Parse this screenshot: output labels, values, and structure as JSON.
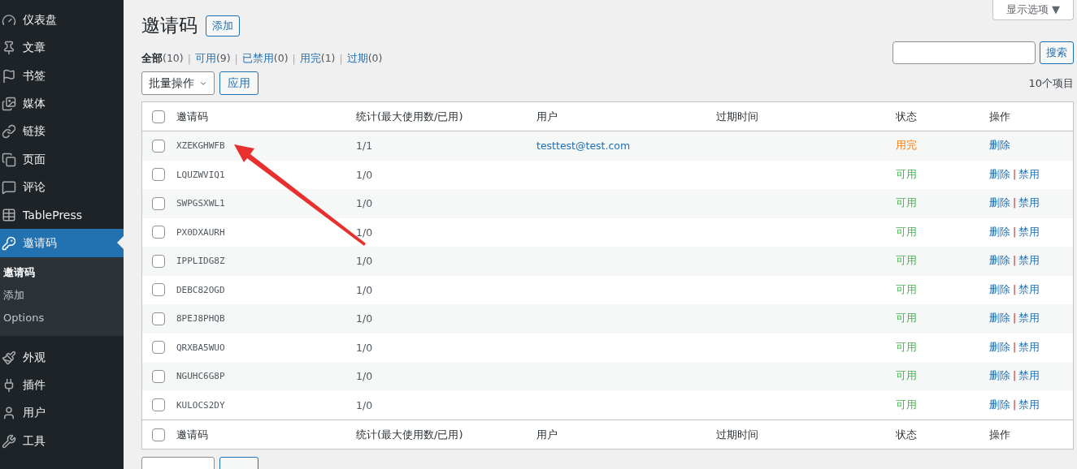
{
  "sidebar": {
    "items_top": [
      {
        "label": "仪表盘"
      },
      {
        "label": "文章"
      },
      {
        "label": "书签"
      },
      {
        "label": "媒体"
      },
      {
        "label": "链接"
      },
      {
        "label": "页面"
      },
      {
        "label": "评论"
      },
      {
        "label": "TablePress"
      },
      {
        "label": "邀请码",
        "selected": true
      }
    ],
    "submenu": [
      {
        "label": "邀请码",
        "selected": true
      },
      {
        "label": "添加",
        "selected": false
      },
      {
        "label": "Options",
        "selected": false
      }
    ],
    "items_bottom": [
      {
        "label": "外观"
      },
      {
        "label": "插件"
      },
      {
        "label": "用户"
      },
      {
        "label": "工具"
      }
    ]
  },
  "screen_options": "显示选项 ▼",
  "page_title": "邀请码",
  "add_button": "添加",
  "filters": {
    "separator": "|",
    "items": [
      {
        "label": "全部",
        "count": "(10)",
        "selected": true
      },
      {
        "label": "可用",
        "count": "(9)",
        "selected": false
      },
      {
        "label": "已禁用",
        "count": "(0)",
        "selected": false
      },
      {
        "label": "用完",
        "count": "(1)",
        "selected": false
      },
      {
        "label": "过期",
        "count": "(0)",
        "selected": false
      }
    ]
  },
  "search": {
    "button": "搜索"
  },
  "bulk": {
    "select": "批量操作",
    "apply": "应用",
    "count": "10个项目"
  },
  "table": {
    "header_checked": false,
    "footer_checked": false,
    "footer_columns": [
      "邀请码",
      "统计(最大使用数/已用)",
      "用户",
      "过期时间",
      "状态",
      "操作"
    ],
    "columns": [
      "邀请码",
      "统计(最大使用数/已用)",
      "用户",
      "过期时间",
      "状态",
      "操作"
    ],
    "action_separator": "|",
    "rows": [
      {
        "code": "XZEKGHWFB",
        "stats": "1/1",
        "user": "testtest@test.com",
        "status": {
          "label": "用完",
          "kind": "used"
        },
        "actions": [
          "删除"
        ],
        "checked": false
      },
      {
        "code": "LQUZWVIQ1",
        "stats": "1/0",
        "status": {
          "label": "可用",
          "kind": "available"
        },
        "actions": [
          "删除",
          "禁用"
        ],
        "checked": false
      },
      {
        "code": "SWPGSXWL1",
        "stats": "1/0",
        "status": {
          "label": "可用",
          "kind": "available"
        },
        "actions": [
          "删除",
          "禁用"
        ],
        "checked": false
      },
      {
        "code": "PX0DXAURH",
        "stats": "1/0",
        "status": {
          "label": "可用",
          "kind": "available"
        },
        "actions": [
          "删除",
          "禁用"
        ],
        "checked": false
      },
      {
        "code": "IPPLIDG8Z",
        "stats": "1/0",
        "status": {
          "label": "可用",
          "kind": "available"
        },
        "actions": [
          "删除",
          "禁用"
        ],
        "checked": false
      },
      {
        "code": "DEBC82OGD",
        "stats": "1/0",
        "status": {
          "label": "可用",
          "kind": "available"
        },
        "actions": [
          "删除",
          "禁用"
        ],
        "checked": false
      },
      {
        "code": "8PEJ8PHQB",
        "stats": "1/0",
        "status": {
          "label": "可用",
          "kind": "available"
        },
        "actions": [
          "删除",
          "禁用"
        ],
        "checked": false
      },
      {
        "code": "QRXBA5WUO",
        "stats": "1/0",
        "status": {
          "label": "可用",
          "kind": "available"
        },
        "actions": [
          "删除",
          "禁用"
        ],
        "checked": false
      },
      {
        "code": "NGUHC6G8P",
        "stats": "1/0",
        "status": {
          "label": "可用",
          "kind": "available"
        },
        "actions": [
          "删除",
          "禁用"
        ],
        "checked": false
      },
      {
        "code": "KULOCS2DY",
        "stats": "1/0",
        "status": {
          "label": "可用",
          "kind": "available"
        },
        "actions": [
          "删除",
          "禁用"
        ],
        "checked": false
      }
    ]
  }
}
